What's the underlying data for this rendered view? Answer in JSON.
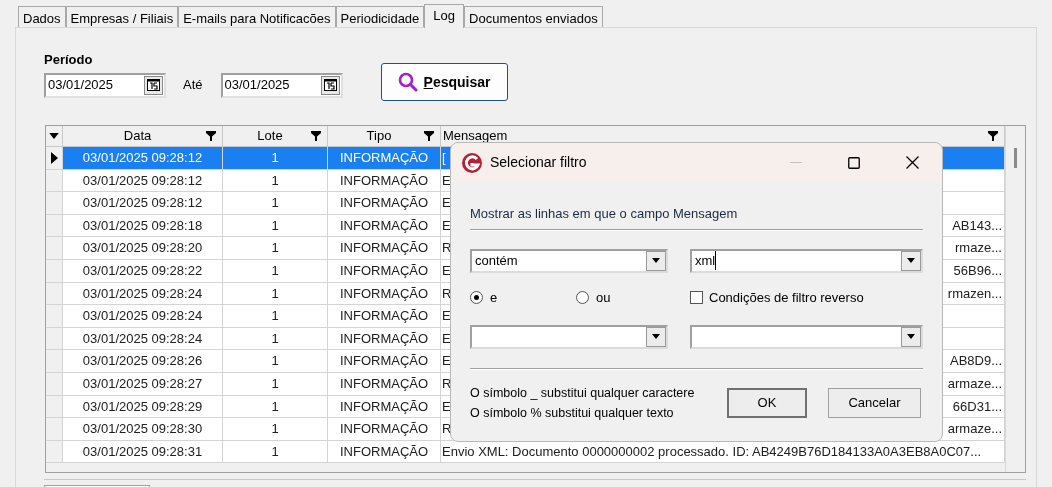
{
  "tabs": [
    {
      "label": "Dados",
      "selected": false
    },
    {
      "label": "Empresas / Filiais",
      "selected": false
    },
    {
      "label": "E-mails para Notificacões",
      "selected": false
    },
    {
      "label": "Periodicidade",
      "selected": false
    },
    {
      "label": "Log",
      "selected": true
    },
    {
      "label": "Documentos enviados",
      "selected": false
    }
  ],
  "period": {
    "label": "Período",
    "from": "03/01/2025",
    "to_label": "Até",
    "to": "03/01/2025",
    "search_button": "Pesquisar"
  },
  "table": {
    "columns": [
      "Data",
      "Lote",
      "Tipo",
      "Mensagem"
    ],
    "rows": [
      {
        "data": "03/01/2025 09:28:12",
        "lote": "1",
        "tipo": "INFORMAÇÃO",
        "message_start": "[",
        "message_end": "",
        "selected": true
      },
      {
        "data": "03/01/2025 09:28:12",
        "lote": "1",
        "tipo": "INFORMAÇÃO",
        "message_start": "E",
        "message_end": "",
        "selected": false
      },
      {
        "data": "03/01/2025 09:28:12",
        "lote": "1",
        "tipo": "INFORMAÇÃO",
        "message_start": "E",
        "message_end": "",
        "selected": false
      },
      {
        "data": "03/01/2025 09:28:18",
        "lote": "1",
        "tipo": "INFORMAÇÃO",
        "message_start": "E",
        "message_end": "AB143...",
        "selected": false
      },
      {
        "data": "03/01/2025 09:28:20",
        "lote": "1",
        "tipo": "INFORMAÇÃO",
        "message_start": "R",
        "message_end": "rmaze...",
        "selected": false
      },
      {
        "data": "03/01/2025 09:28:22",
        "lote": "1",
        "tipo": "INFORMAÇÃO",
        "message_start": "E",
        "message_end": "56B96...",
        "selected": false
      },
      {
        "data": "03/01/2025 09:28:24",
        "lote": "1",
        "tipo": "INFORMAÇÃO",
        "message_start": "R",
        "message_end": "rmazen...",
        "selected": false
      },
      {
        "data": "03/01/2025 09:28:24",
        "lote": "1",
        "tipo": "INFORMAÇÃO",
        "message_start": "E",
        "message_end": "",
        "selected": false
      },
      {
        "data": "03/01/2025 09:28:24",
        "lote": "1",
        "tipo": "INFORMAÇÃO",
        "message_start": "E",
        "message_end": "",
        "selected": false
      },
      {
        "data": "03/01/2025 09:28:26",
        "lote": "1",
        "tipo": "INFORMAÇÃO",
        "message_start": "E",
        "message_end": "AB8D9...",
        "selected": false
      },
      {
        "data": "03/01/2025 09:28:27",
        "lote": "1",
        "tipo": "INFORMAÇÃO",
        "message_start": "R",
        "message_end": "armaze...",
        "selected": false
      },
      {
        "data": "03/01/2025 09:28:29",
        "lote": "1",
        "tipo": "INFORMAÇÃO",
        "message_start": "E",
        "message_end": "66D31...",
        "selected": false
      },
      {
        "data": "03/01/2025 09:28:30",
        "lote": "1",
        "tipo": "INFORMAÇÃO",
        "message_start": "R",
        "message_end": "armaze...",
        "selected": false
      },
      {
        "data": "03/01/2025 09:28:31",
        "lote": "1",
        "tipo": "INFORMAÇÃO",
        "message_start": "Envio XML: Documento 0000000002 processado. ID: AB4249B76D184133A0A3EB8A0C07...",
        "message_end": "",
        "selected": false
      }
    ]
  },
  "dialog": {
    "title": "Selecionar filtro",
    "prompt": "Mostrar as linhas em que o campo Mensagem",
    "operator": "contém",
    "value": "xml",
    "radios": [
      {
        "label": "e",
        "selected": true
      },
      {
        "label": "ou",
        "selected": false
      }
    ],
    "reverse": {
      "label": "Condições de filtro reverso",
      "checked": false
    },
    "hints": [
      "O símbolo _ substitui qualquer caractere",
      "O símbolo % substitui qualquer texto"
    ],
    "buttons": [
      "OK",
      "Cancelar"
    ]
  }
}
